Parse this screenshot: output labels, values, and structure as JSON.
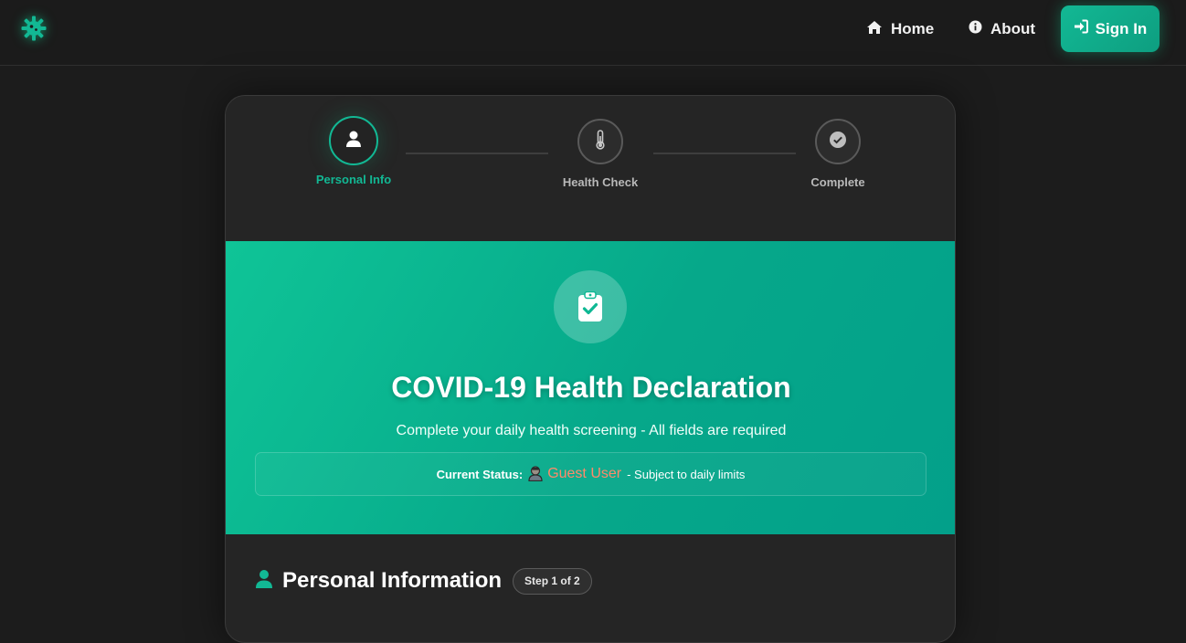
{
  "navbar": {
    "logo_icon": "virus-gear-icon",
    "links": [
      {
        "label": "Home",
        "icon": "home-icon"
      },
      {
        "label": "About",
        "icon": "info-icon"
      }
    ],
    "signin": {
      "label": "Sign In",
      "icon": "sign-in-icon"
    }
  },
  "stepper": {
    "steps": [
      {
        "label": "Personal Info",
        "icon": "user-icon",
        "state": "active"
      },
      {
        "label": "Health Check",
        "icon": "thermometer-icon",
        "state": "pending"
      },
      {
        "label": "Complete",
        "icon": "check-circle-icon",
        "state": "pending"
      }
    ]
  },
  "hero": {
    "icon": "clipboard-check-icon",
    "title": "COVID-19 Health Declaration",
    "subtitle": "Complete your daily health screening - All fields are required",
    "status": {
      "label": "Current Status:",
      "user_icon": "guest-user-icon",
      "user": "Guest User",
      "rest": "- Subject to daily limits"
    }
  },
  "section": {
    "icon": "user-icon",
    "title": "Personal Information",
    "badge": "Step 1 of 2"
  },
  "colors": {
    "accent": "#12b894",
    "background": "#1c1c1c",
    "card": "#252525",
    "guest_user": "#ff8a6a"
  }
}
